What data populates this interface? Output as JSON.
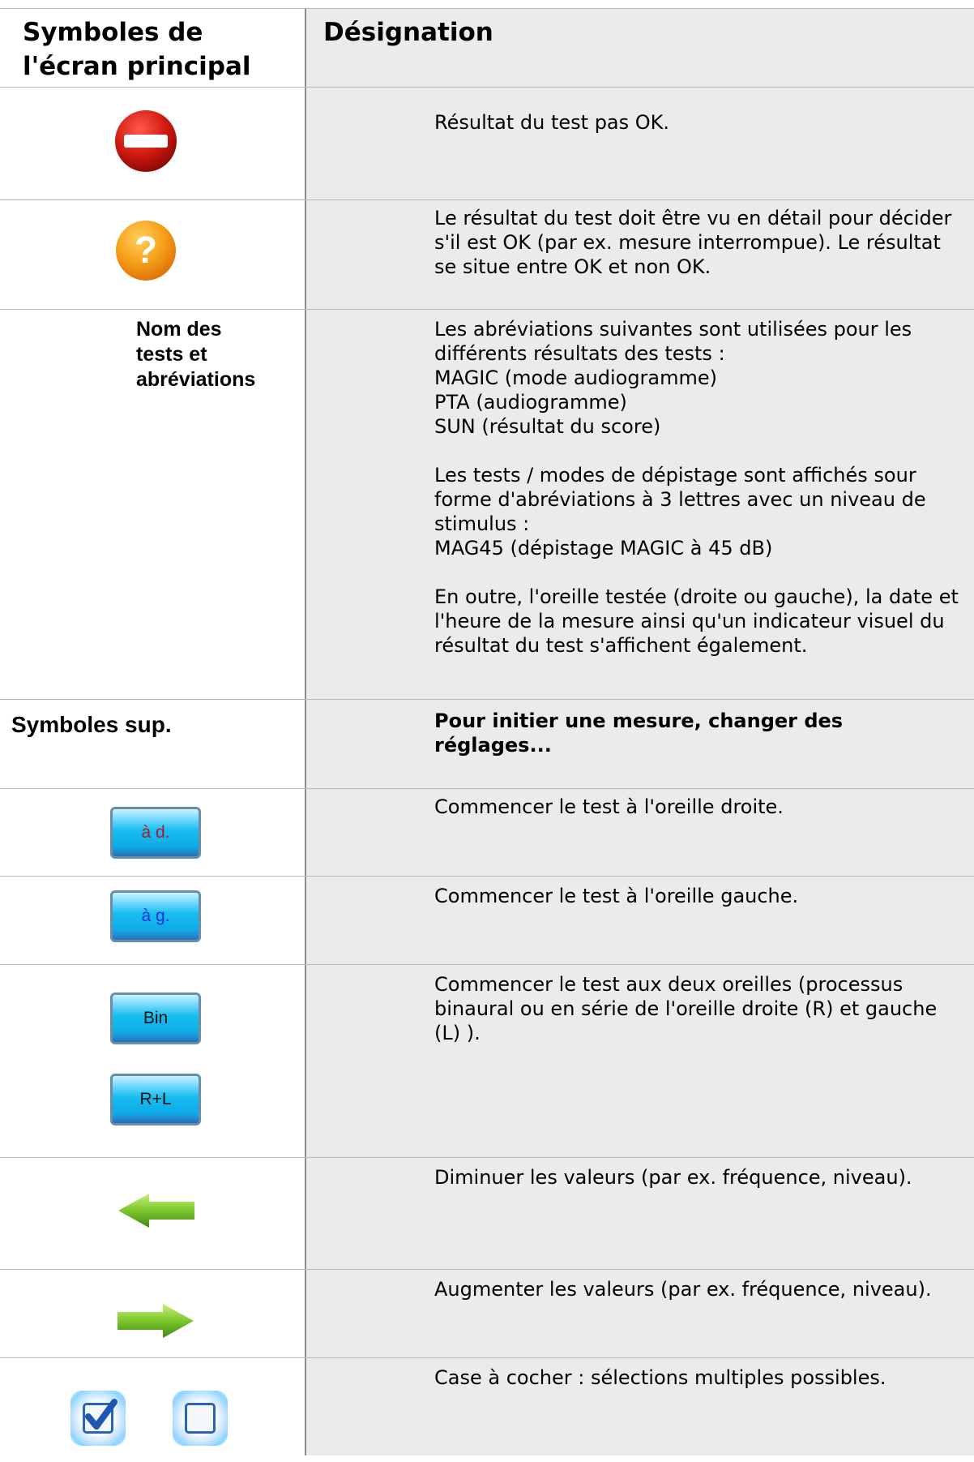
{
  "header": {
    "left": "Symboles de\nl'écran principal",
    "right": "Désignation"
  },
  "rows": [
    {
      "icon": "stop-icon",
      "desc": "Résultat du test pas OK."
    },
    {
      "icon": "question-icon",
      "desc": "Le résultat du test doit être vu en détail pour décider s'il est OK (par ex. mesure interrompue). Le résultat se situe entre OK et non OK."
    },
    {
      "label": "Nom des\ntests et\nabréviations",
      "desc": "Les abréviations suivantes sont utilisées pour les différents résultats des tests :\nMAGIC (mode audiogramme)\nPTA (audiogramme)\nSUN (résultat du score)\n\nLes tests / modes de dépistage sont affichés sour forme d'abréviations à 3 lettres avec un niveau de stimulus :\nMAG45 (dépistage MAGIC à 45 dB)\n\nEn outre, l'oreille testée (droite ou gauche), la date et l'heure de la mesure ainsi qu'un indicateur visuel du résultat du test s'affichent également."
    },
    {
      "label": "Symboles sup.",
      "desc": "Pour initier une mesure, changer des\nréglages..."
    },
    {
      "button": "à d.",
      "button_color": "#b0182a",
      "desc": "Commencer le test à l'oreille droite."
    },
    {
      "button": "à g.",
      "button_color": "#1c2fe0",
      "desc": "Commencer le test à l'oreille gauche."
    },
    {
      "buttons": [
        "Bin",
        "R+L"
      ],
      "desc": "Commencer le test aux deux oreilles (processus binaural ou en série de l'oreille droite (R) et gauche (L) )."
    },
    {
      "icon": "arrow-left-icon",
      "desc": "Diminuer les valeurs (par ex. fréquence, niveau)."
    },
    {
      "icon": "arrow-right-icon",
      "desc": "Augmenter les valeurs (par ex. fréquence, niveau)."
    },
    {
      "icons": [
        "checkbox-checked-icon",
        "checkbox-empty-icon"
      ],
      "desc": "Case à cocher : sélections multiples possibles."
    }
  ]
}
